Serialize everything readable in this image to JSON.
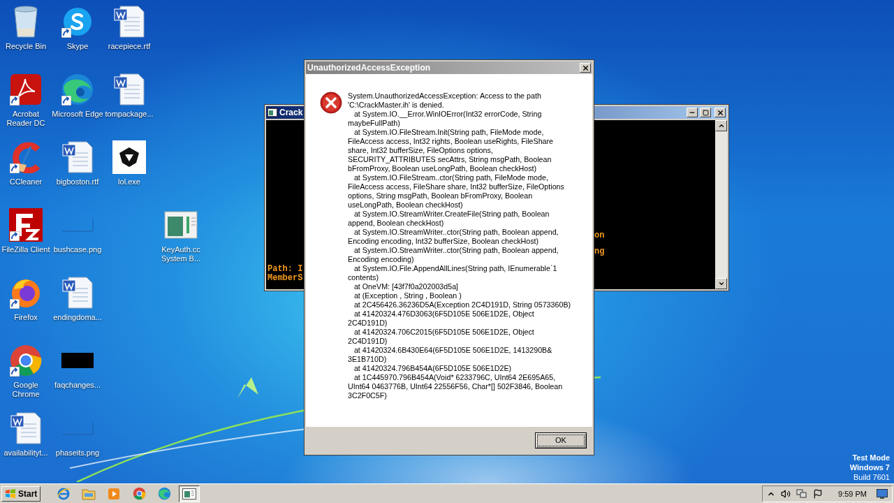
{
  "desktop_icons": [
    {
      "label": "Recycle Bin",
      "kind": "recycle-bin",
      "shortcut": false
    },
    {
      "label": "Skype",
      "kind": "skype",
      "shortcut": true
    },
    {
      "label": "racepiece.rtf",
      "kind": "word-doc",
      "shortcut": false
    },
    {
      "label": "Acrobat Reader DC",
      "kind": "acrobat",
      "shortcut": true
    },
    {
      "label": "Microsoft Edge",
      "kind": "edge",
      "shortcut": true
    },
    {
      "label": "tompackage...",
      "kind": "word-doc",
      "shortcut": false
    },
    {
      "label": "CCleaner",
      "kind": "ccleaner",
      "shortcut": true
    },
    {
      "label": "bigboston.rtf",
      "kind": "word-doc",
      "shortcut": false
    },
    {
      "label": "lol.exe",
      "kind": "emblem",
      "shortcut": false
    },
    {
      "label": "FileZilla Client",
      "kind": "filezilla",
      "shortcut": true
    },
    {
      "label": "bushcase.png",
      "kind": "blank-image",
      "shortcut": false
    },
    {
      "label": "KeyAuth.cc System B...",
      "kind": "window-thumb",
      "shortcut": false
    },
    {
      "label": "Firefox",
      "kind": "firefox",
      "shortcut": true
    },
    {
      "label": "endingdoma...",
      "kind": "word-doc",
      "shortcut": false
    },
    {
      "label": "Google Chrome",
      "kind": "chrome",
      "shortcut": true
    },
    {
      "label": "faqchanges...",
      "kind": "black-image",
      "shortcut": false
    },
    {
      "label": "availabilityt...",
      "kind": "word-doc",
      "shortcut": false
    },
    {
      "label": "phaseits.png",
      "kind": "blank-image",
      "shortcut": false
    }
  ],
  "console_window": {
    "title": "Crack",
    "left_lines": [
      "Path: I",
      "MemberS"
    ],
    "right_lines": [
      "on",
      "ng"
    ]
  },
  "dialog": {
    "title": "UnauthorizedAccessException",
    "message_lines": [
      "System.UnauthorizedAccessException: Access to the path 'C:\\CrackMaster.ih' is denied.",
      "   at System.IO.__Error.WinIOError(Int32 errorCode, String maybeFullPath)",
      "   at System.IO.FileStream.Init(String path, FileMode mode, FileAccess access, Int32 rights, Boolean useRights, FileShare share, Int32 bufferSize, FileOptions options, SECURITY_ATTRIBUTES secAttrs, String msgPath, Boolean bFromProxy, Boolean useLongPath, Boolean checkHost)",
      "   at System.IO.FileStream..ctor(String path, FileMode mode, FileAccess access, FileShare share, Int32 bufferSize, FileOptions options, String msgPath, Boolean bFromProxy, Boolean useLongPath, Boolean checkHost)",
      "   at System.IO.StreamWriter.CreateFile(String path, Boolean append, Boolean checkHost)",
      "   at System.IO.StreamWriter..ctor(String path, Boolean append, Encoding encoding, Int32 bufferSize, Boolean checkHost)",
      "   at System.IO.StreamWriter..ctor(String path, Boolean append, Encoding encoding)",
      "   at System.IO.File.AppendAllLines(String path, IEnumerable`1 contents)",
      "   at OneVM: [43f7f0a202003d5a]",
      "   at (Exception , String , Boolean )",
      "   at 2C456426.36236D5A(Exception 2C4D191D, String 0573360B)",
      "   at 41420324.476D3063(6F5D105E 506E1D2E, Object 2C4D191D)",
      "   at 41420324.706C2015(6F5D105E 506E1D2E, Object 2C4D191D)",
      "   at 41420324.6B430E64(6F5D105E 506E1D2E, 1413290B& 3E1B710D)",
      "   at 41420324.796B454A(6F5D105E 506E1D2E)",
      "   at 1C445970.796B454A(Void* 6233796C, UInt64 2E695A65, UInt64 0463776B, UInt64 22556F56, Char*[] 502F3846, Boolean 3C2F0C5F)"
    ],
    "ok_button": "OK"
  },
  "watermark_os": {
    "line1": "Test Mode",
    "line2": "Windows 7",
    "line3": "Build 7601"
  },
  "taskbar": {
    "start": "Start",
    "apps": [
      {
        "kind": "ie",
        "selected": false
      },
      {
        "kind": "explorer",
        "selected": false
      },
      {
        "kind": "media",
        "selected": false
      },
      {
        "kind": "chrome",
        "selected": false
      },
      {
        "kind": "edge",
        "selected": false
      },
      {
        "kind": "console",
        "selected": true
      }
    ],
    "clock": "9:59 PM"
  }
}
